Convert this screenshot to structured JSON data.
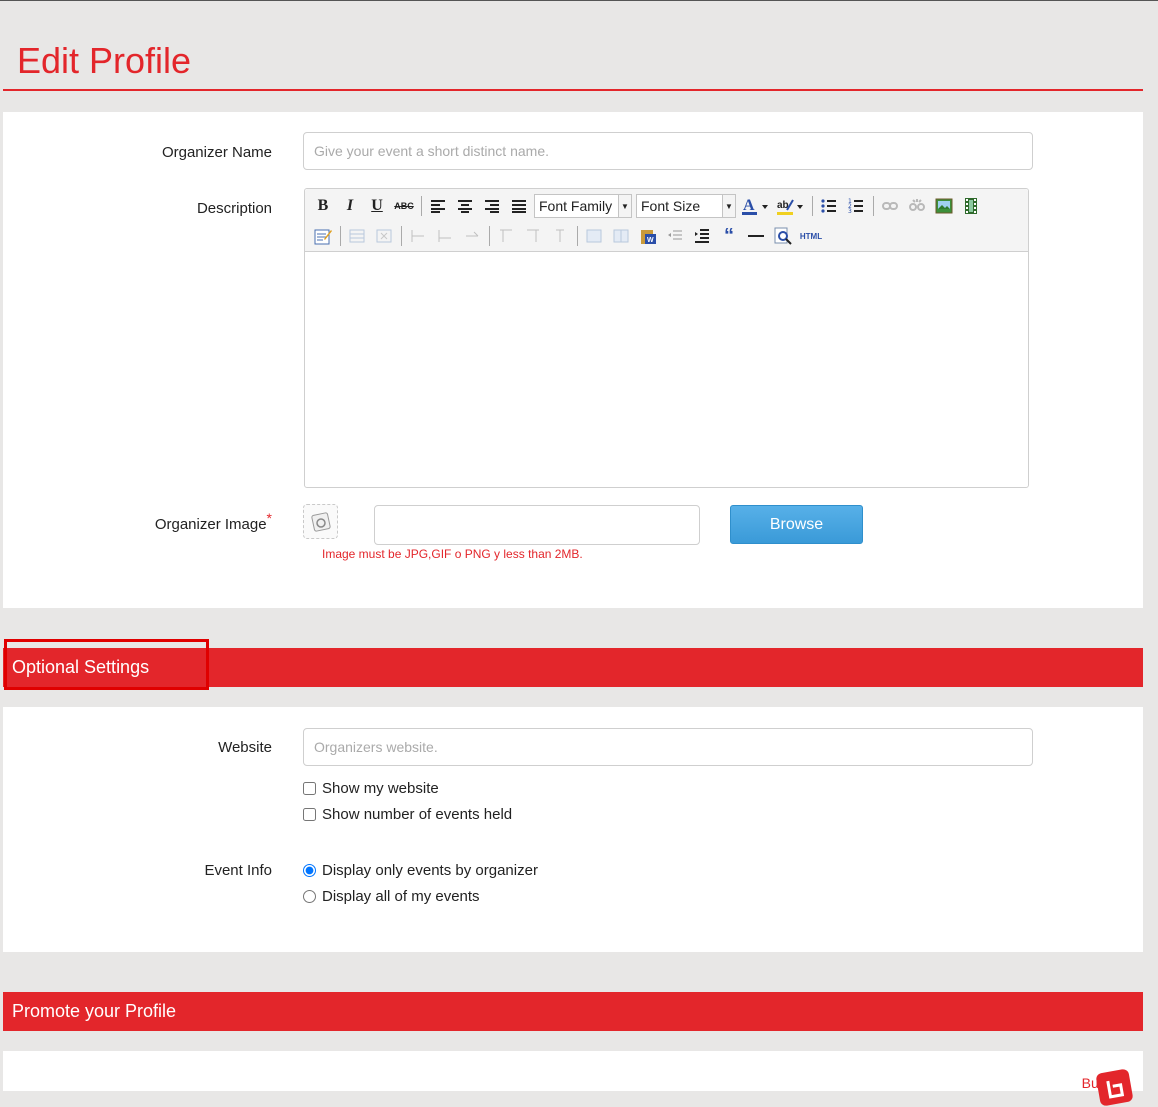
{
  "page": {
    "title": "Edit Profile"
  },
  "profile": {
    "organizer_name_label": "Organizer Name",
    "organizer_name_placeholder": "Give your event a short distinct name.",
    "organizer_name_value": "",
    "description_label": "Description",
    "organizer_image_label": "Organizer Image",
    "required_mark": "*",
    "file_value": "",
    "browse_label": "Browse",
    "image_hint": "Image must be JPG,GIF o PNG y less than 2MB."
  },
  "editor": {
    "font_family_label": "Font Family",
    "font_size_label": "Font Size",
    "row1_icons": [
      "bold-icon",
      "italic-icon",
      "underline-icon",
      "strikethrough-icon",
      "align-left-icon",
      "align-center-icon",
      "align-right-icon",
      "align-justify-icon",
      "font-family-select",
      "font-size-select",
      "font-color-icon",
      "highlight-color-icon",
      "bullet-list-icon",
      "numbered-list-icon",
      "link-icon",
      "unlink-icon",
      "image-icon",
      "media-icon"
    ],
    "row2_icons": [
      "edit-source-icon",
      "table-icon",
      "table-delete-icon",
      "row-before-icon",
      "row-after-icon",
      "row-delete-icon",
      "col-before-icon",
      "col-after-icon",
      "col-delete-icon",
      "merge-cells-icon",
      "split-cells-icon",
      "paste-word-icon",
      "outdent-icon",
      "indent-icon",
      "blockquote-icon",
      "horizontal-rule-icon",
      "preview-icon",
      "html-icon"
    ],
    "text_glyphs": {
      "bold": "B",
      "italic": "I",
      "underline": "U",
      "strike": "ABC",
      "quote": "“",
      "html": "HTML"
    }
  },
  "optional": {
    "section_title": "Optional Settings",
    "website_label": "Website",
    "website_placeholder": "Organizers website.",
    "website_value": "",
    "show_website_label": "Show my website",
    "show_website_checked": false,
    "show_events_label": "Show number of events held",
    "show_events_checked": false,
    "event_info_label": "Event Info",
    "event_option_1": "Display only events by organizer",
    "event_option_2": "Display all of my events",
    "selected_event_option": 1
  },
  "promote": {
    "section_title": "Promote your Profile",
    "button_label": "Button:"
  },
  "colors": {
    "accent": "#e3262b",
    "button": "#3d9fdd",
    "background": "#e8e7e6"
  }
}
